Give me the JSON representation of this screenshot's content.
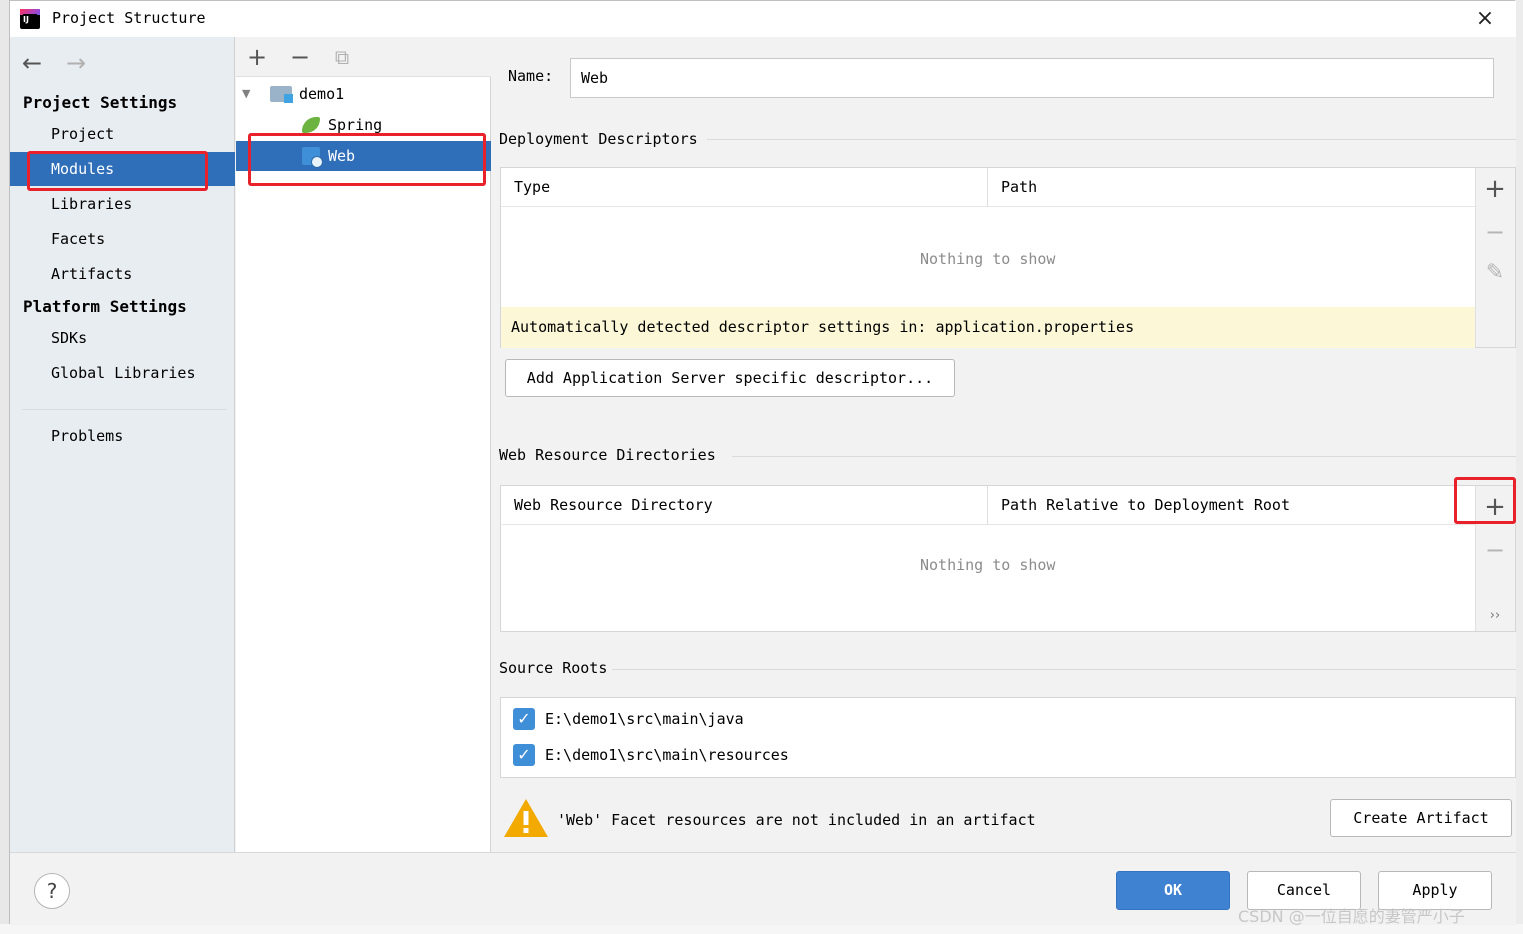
{
  "window": {
    "title": "Project Structure",
    "close_glyph": "×"
  },
  "nav": {
    "back_glyph": "←",
    "forward_glyph": "→",
    "project_settings_heading": "Project Settings",
    "platform_settings_heading": "Platform Settings",
    "items": [
      {
        "label": "Project"
      },
      {
        "label": "Modules"
      },
      {
        "label": "Libraries"
      },
      {
        "label": "Facets"
      },
      {
        "label": "Artifacts"
      },
      {
        "label": "SDKs"
      },
      {
        "label": "Global Libraries"
      },
      {
        "label": "Problems"
      }
    ],
    "selected": "Modules"
  },
  "tree": {
    "toolbar": {
      "add": "+",
      "remove": "−",
      "copy": "⧉"
    },
    "expand_glyph": "▼",
    "nodes": [
      {
        "label": "demo1",
        "icon": "module-folder-icon"
      },
      {
        "label": "Spring",
        "icon": "spring-leaf-icon"
      },
      {
        "label": "Web",
        "icon": "web-facet-icon"
      }
    ],
    "selected": "Web"
  },
  "facet": {
    "name_label": "Name:",
    "name_value": "Web",
    "deployment_descriptors": {
      "title": "Deployment Descriptors",
      "columns": [
        "Type",
        "Path"
      ],
      "empty_text": "Nothing to show",
      "info_text": "Automatically detected descriptor settings in: application.properties",
      "add_server_button": "Add Application Server specific descriptor..."
    },
    "web_resource_dirs": {
      "title": "Web Resource Directories",
      "columns": [
        "Web Resource Directory",
        "Path Relative to Deployment Root"
      ],
      "empty_text": "Nothing to show",
      "more_glyph": "››"
    },
    "source_roots": {
      "title": "Source Roots",
      "items": [
        {
          "path": "E:\\demo1\\src\\main\\java",
          "checked": true
        },
        {
          "path": "E:\\demo1\\src\\main\\resources",
          "checked": true
        }
      ]
    },
    "warning": {
      "text": "'Web' Facet resources are not included in an artifact",
      "button": "Create Artifact"
    },
    "side_toolbar": {
      "add": "+",
      "remove": "−",
      "edit": "✎"
    }
  },
  "footer": {
    "help": "?",
    "ok": "OK",
    "cancel": "Cancel",
    "apply": "Apply"
  },
  "watermark": "CSDN @一位自愿的妻管严小子",
  "colors": {
    "selection": "#2f6fba",
    "annotation_red": "#e8212a",
    "info_strip": "#fbf7d7",
    "primary_button": "#3f82d1"
  }
}
